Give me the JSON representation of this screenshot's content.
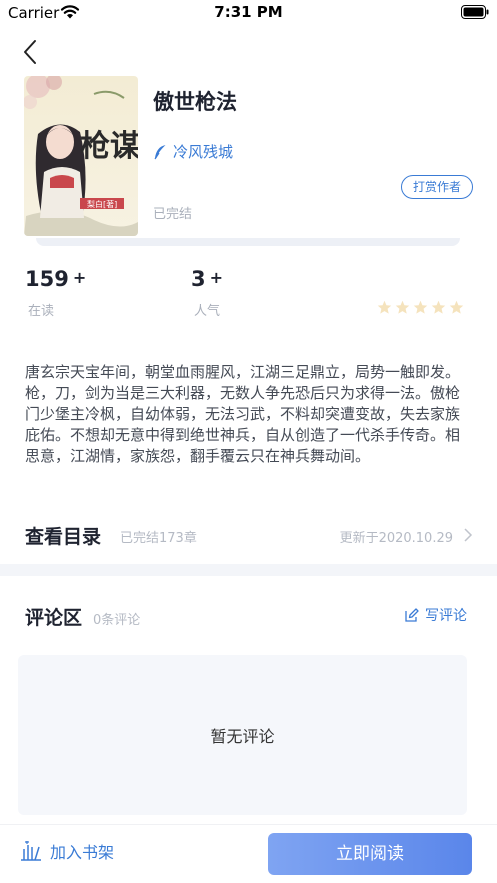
{
  "status_bar": {
    "carrier": "Carrier",
    "time": "7:31 PM"
  },
  "book": {
    "title": "傲世枪法",
    "author": "冷风残城",
    "status": "已完结",
    "reward_label": "打赏作者",
    "cover_text": {
      "main": "枪谋",
      "author": "梨白[著]"
    }
  },
  "stats": [
    {
      "value": "159",
      "suffix": "+",
      "label": "在读"
    },
    {
      "value": "3",
      "suffix": "+",
      "label": "人气"
    }
  ],
  "rating": {
    "stars": 5,
    "filled": 0,
    "star_color": "#f5e3bd"
  },
  "description": "唐玄宗天宝年间，朝堂血雨腥风，江湖三足鼎立，局势一触即发。枪，刀，剑为当是三大利器，无数人争先恐后只为求得一法。傲枪门少堡主冷枫，自幼体弱，无法习武，不料却突遭变故，失去家族庇佑。不想却无意中得到绝世神兵，自从创造了一代杀手传奇。相思意，江湖情，家族怨，翻手覆云只在神兵舞动间。",
  "catalog": {
    "title": "查看目录",
    "chapters": "已完结173章",
    "updated": "更新于2020.10.29"
  },
  "comments": {
    "title": "评论区",
    "count": "0条评论",
    "write_label": "写评论",
    "empty_text": "暂无评论"
  },
  "bottom": {
    "shelf_label": "加入书架",
    "read_label": "立即阅读"
  },
  "colors": {
    "accent": "#3a7bd5",
    "read_button": "#6b93ee"
  }
}
